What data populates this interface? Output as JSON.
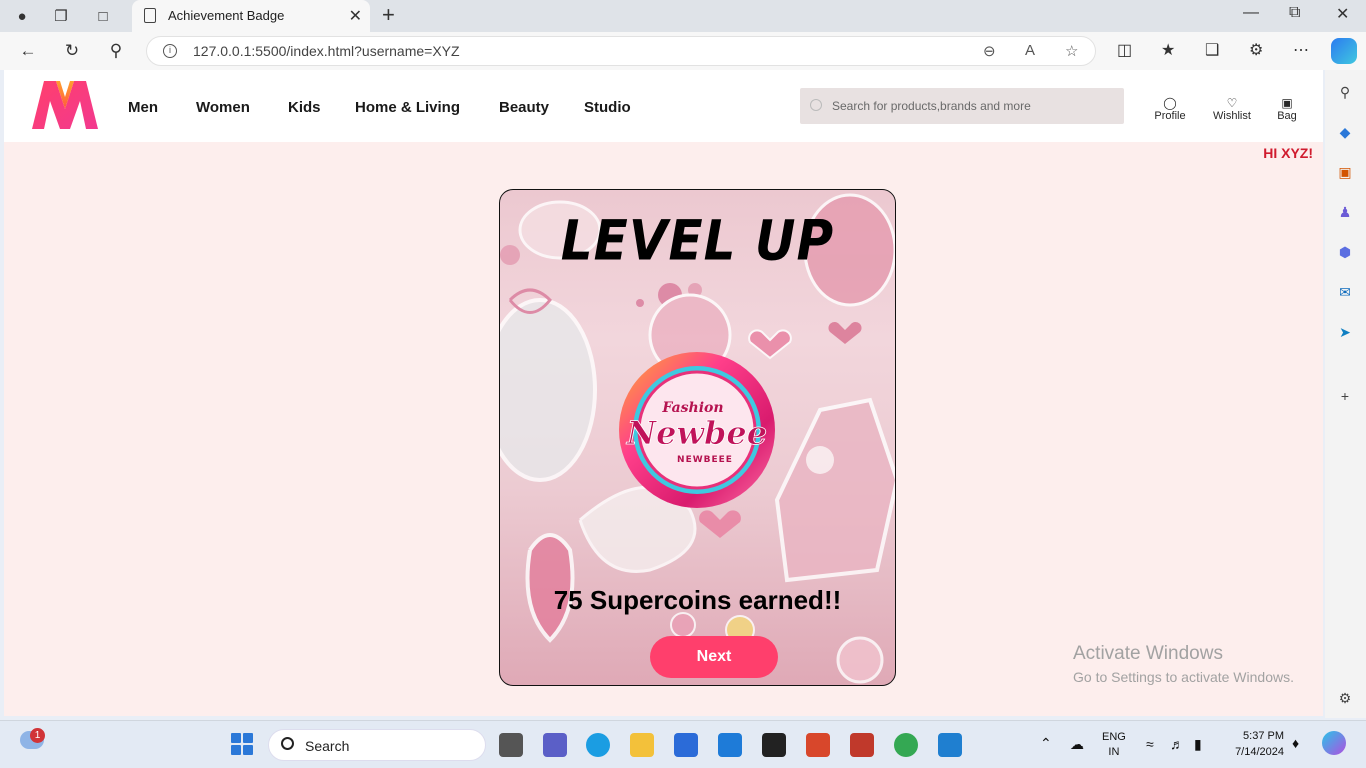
{
  "browser": {
    "tab_title": "Achievement Badge",
    "url": "127.0.0.1:5500/index.html?username=XYZ"
  },
  "site": {
    "nav": [
      "Men",
      "Women",
      "Kids",
      "Home & Living",
      "Beauty",
      "Studio"
    ],
    "search_placeholder": "Search for products,brands and more",
    "actions": {
      "profile": "Profile",
      "wishlist": "Wishlist",
      "bag": "Bag"
    },
    "greeting": "HI XYZ!"
  },
  "card": {
    "title": "LEVEL UP",
    "badge_small": "Fashion",
    "badge_main": "Newbee",
    "badge_sub": "NEWBEEE",
    "earned": "75 Supercoins earned!!",
    "next_label": "Next"
  },
  "watermark": {
    "line1": "Activate Windows",
    "line2": "Go to Settings to activate Windows."
  },
  "taskbar": {
    "weather_badge": "1",
    "search_label": "Search",
    "lang_top": "ENG",
    "lang_bottom": "IN",
    "time": "5:37 PM",
    "date": "7/14/2024"
  },
  "colors": {
    "accent": "#ff3f6c",
    "greeting": "#d01b2e",
    "page_bg": "#fdeeed"
  }
}
